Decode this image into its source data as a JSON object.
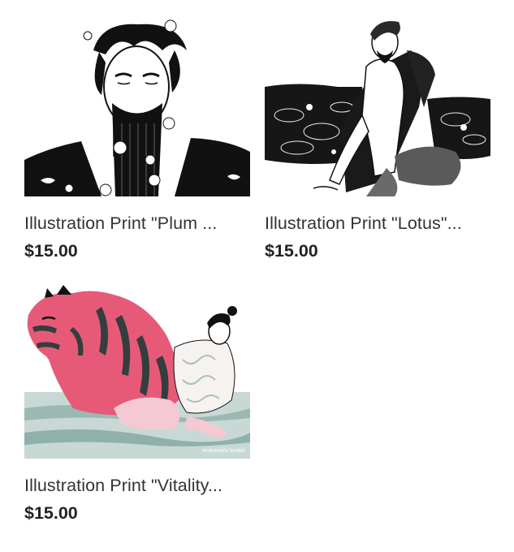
{
  "products": [
    {
      "title": "Illustration Print \"Plum ...",
      "price": "$15.00",
      "image": "ink illustration of a bearded man with plum blossoms"
    },
    {
      "title": "Illustration Print \"Lotus\"...",
      "price": "$15.00",
      "image": "ink illustration of a man seated among lotus leaves"
    },
    {
      "title": "Illustration Print \"Vitality...",
      "price": "$15.00",
      "image": "pink tiger and man in water illustration",
      "watermark": "emkonishi.tumblr"
    }
  ],
  "colors": {
    "title": "#333333",
    "price": "#222222",
    "tiger_pink": "#e65a78",
    "ink": "#111111",
    "water": "#9cb8b3"
  }
}
